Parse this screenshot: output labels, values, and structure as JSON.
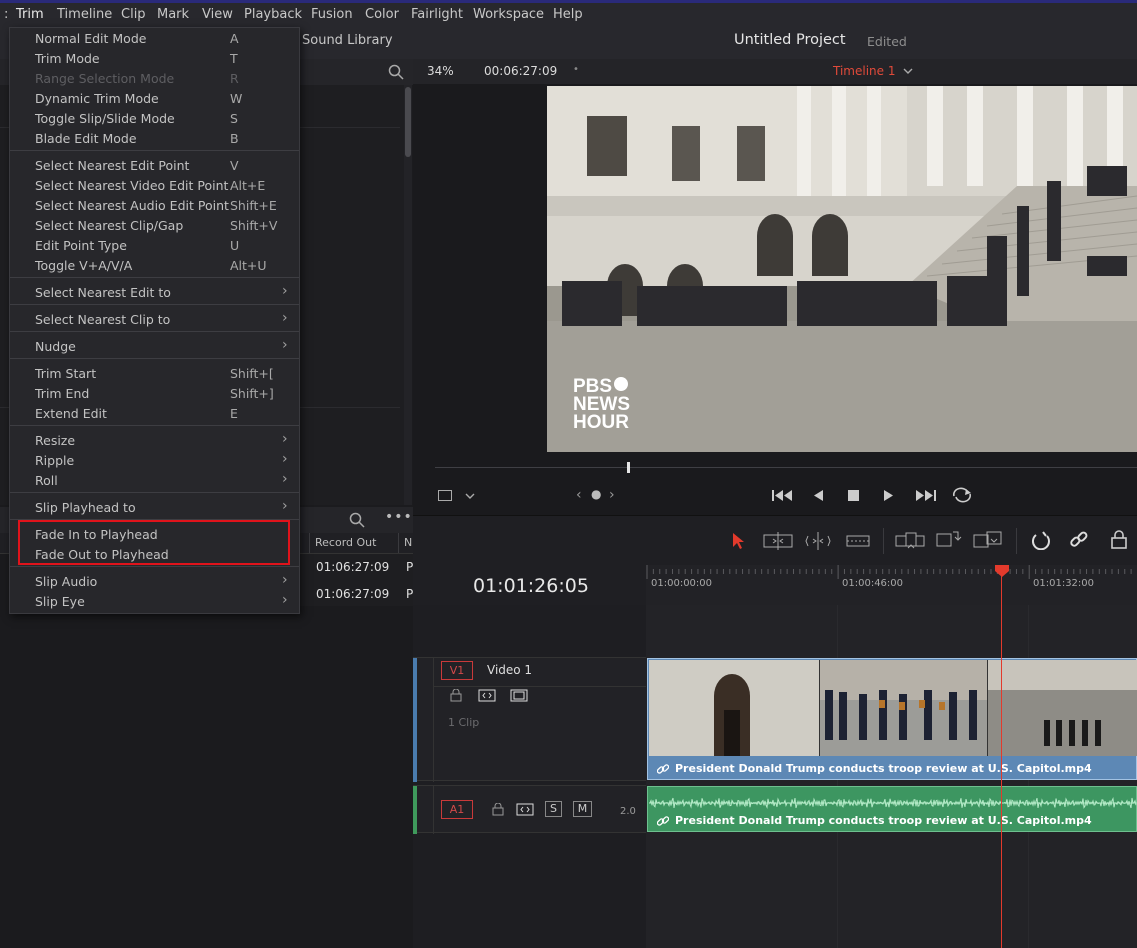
{
  "menubar": {
    "items": [
      "Trim",
      "Timeline",
      "Clip",
      "Mark",
      "View",
      "Playback",
      "Fusion",
      "Color",
      "Fairlight",
      "Workspace",
      "Help"
    ]
  },
  "toolbar": {
    "sound_library": "Sound Library",
    "project_title": "Untitled Project",
    "project_status": "Edited"
  },
  "viewer": {
    "zoom": "34%",
    "timecode": "00:06:27:09",
    "timeline_name": "Timeline 1",
    "watermark": [
      "PBS",
      "NEWS",
      "HOUR"
    ]
  },
  "trim_menu": {
    "items": [
      {
        "label": "Normal Edit Mode",
        "shortcut": "A"
      },
      {
        "label": "Trim Mode",
        "shortcut": "T"
      },
      {
        "label": "Range Selection Mode",
        "shortcut": "R",
        "disabled": true
      },
      {
        "label": "Dynamic Trim Mode",
        "shortcut": "W"
      },
      {
        "label": "Toggle Slip/Slide Mode",
        "shortcut": "S"
      },
      {
        "label": "Blade Edit Mode",
        "shortcut": "B"
      },
      {
        "label": "Select Nearest Edit Point",
        "shortcut": "V"
      },
      {
        "label": "Select Nearest Video Edit Point",
        "shortcut": "Alt+E"
      },
      {
        "label": "Select Nearest Audio Edit Point",
        "shortcut": "Shift+E"
      },
      {
        "label": "Select Nearest Clip/Gap",
        "shortcut": "Shift+V"
      },
      {
        "label": "Edit Point Type",
        "shortcut": "U"
      },
      {
        "label": "Toggle V+A/V/A",
        "shortcut": "Alt+U"
      },
      {
        "label": "Select Nearest Edit to",
        "submenu": true
      },
      {
        "label": "Select Nearest Clip to",
        "submenu": true
      },
      {
        "label": "Nudge",
        "submenu": true
      },
      {
        "label": "Trim Start",
        "shortcut": "Shift+["
      },
      {
        "label": "Trim End",
        "shortcut": "Shift+]"
      },
      {
        "label": "Extend Edit",
        "shortcut": "E"
      },
      {
        "label": "Resize",
        "submenu": true
      },
      {
        "label": "Ripple",
        "submenu": true
      },
      {
        "label": "Roll",
        "submenu": true
      },
      {
        "label": "Slip Playhead to",
        "submenu": true
      },
      {
        "label": "Fade In to Playhead"
      },
      {
        "label": "Fade Out to Playhead"
      },
      {
        "label": "Slip Audio",
        "submenu": true
      },
      {
        "label": "Slip Eye",
        "submenu": true
      }
    ]
  },
  "edit_index": {
    "column_record_out": "Record Out",
    "column_n": "N",
    "rows": [
      {
        "record_out": "01:06:27:09",
        "n": "P"
      },
      {
        "record_out": "01:06:27:09",
        "n": "P"
      }
    ]
  },
  "timeline": {
    "current_timecode": "01:01:26:05",
    "ruler_ticks": [
      "01:00:00:00",
      "01:00:46:00",
      "01:01:32:00"
    ],
    "video_track": {
      "badge": "V1",
      "name": "Video 1",
      "clip_count": "1 Clip"
    },
    "audio_track": {
      "badge": "A1",
      "channels": "2.0",
      "s": "S",
      "m": "M"
    },
    "clip_title": "President Donald Trump conducts troop review at U.S. Capitol.mp4"
  }
}
